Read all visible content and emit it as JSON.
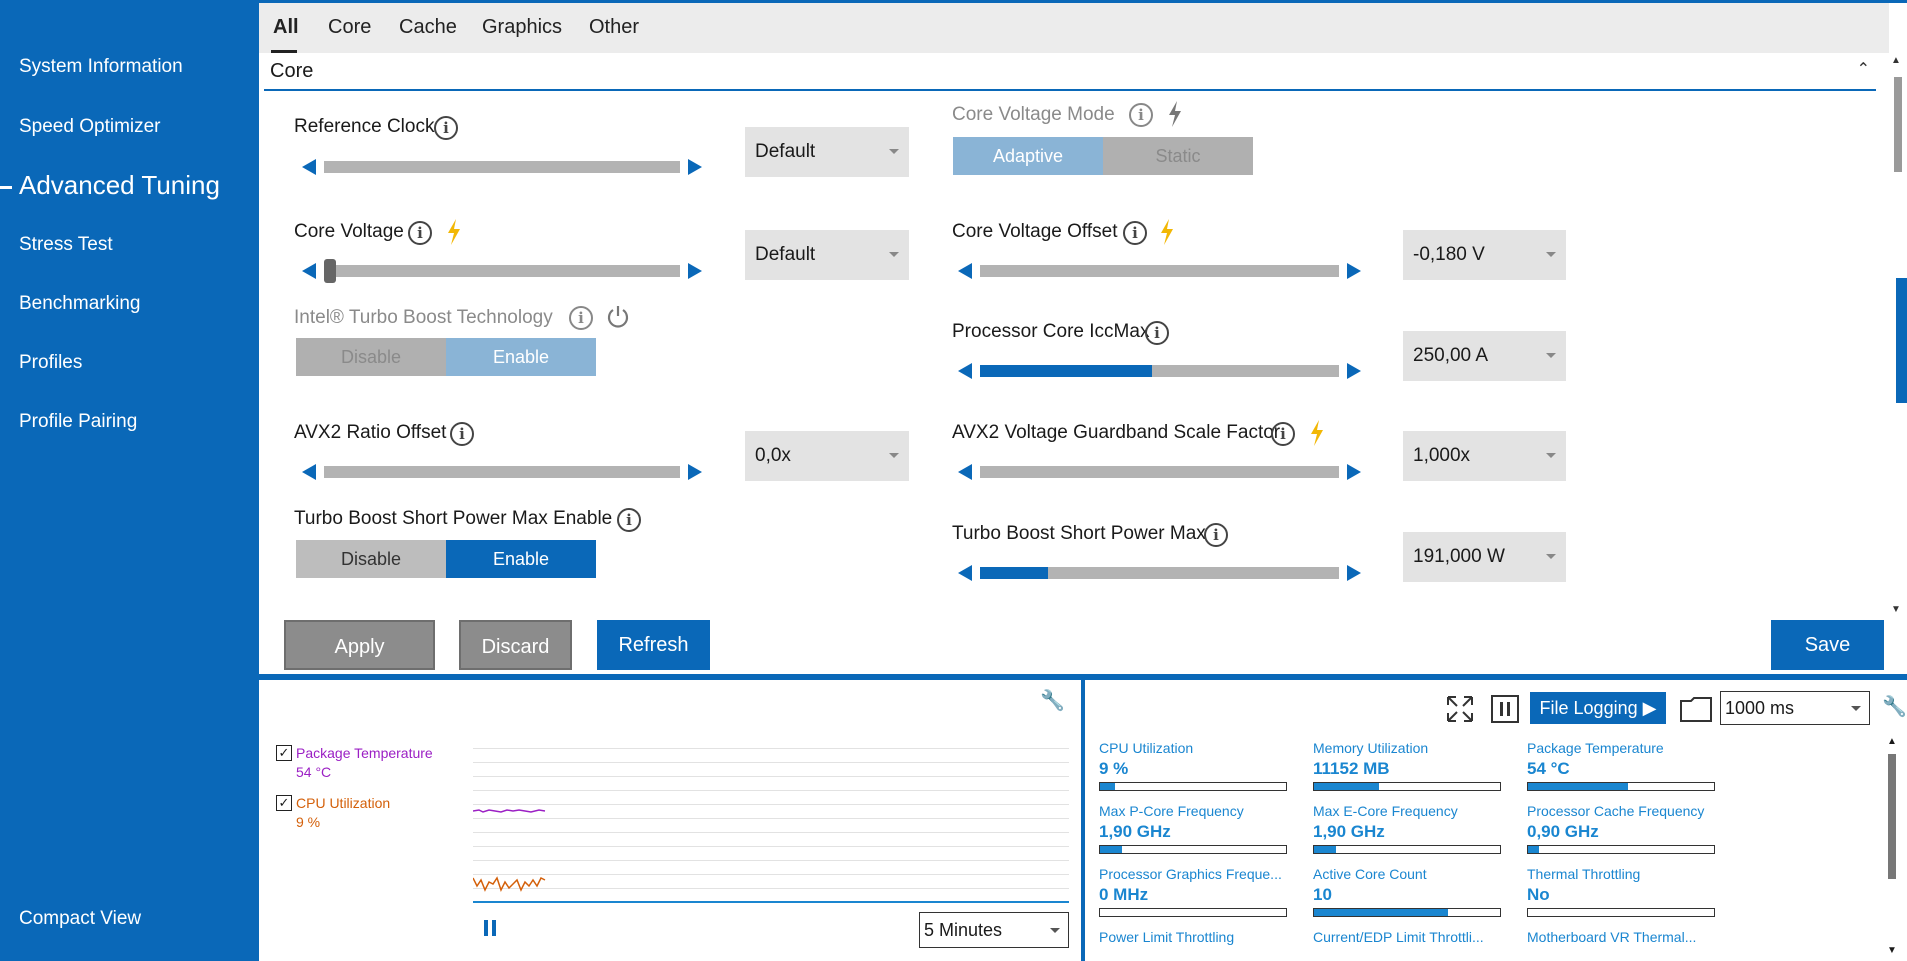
{
  "sidebar": {
    "items": [
      {
        "label": "System Information"
      },
      {
        "label": "Speed Optimizer"
      },
      {
        "label": "Advanced Tuning"
      },
      {
        "label": "Stress Test"
      },
      {
        "label": "Benchmarking"
      },
      {
        "label": "Profiles"
      },
      {
        "label": "Profile Pairing"
      }
    ],
    "active_index": 2,
    "compact_view": "Compact View"
  },
  "tabs": [
    {
      "label": "All"
    },
    {
      "label": "Core"
    },
    {
      "label": "Cache"
    },
    {
      "label": "Graphics"
    },
    {
      "label": "Other"
    }
  ],
  "section": {
    "title": "Core"
  },
  "controls": {
    "reference_clock": {
      "label": "Reference Clock",
      "dropdown": "Default"
    },
    "core_voltage": {
      "label": "Core Voltage",
      "dropdown": "Default"
    },
    "turbo_boost_tech": {
      "label": "Intel® Turbo Boost Technology",
      "disable": "Disable",
      "enable": "Enable",
      "selected": "Enable"
    },
    "avx2_ratio_offset": {
      "label": "AVX2 Ratio Offset",
      "dropdown": "0,0x"
    },
    "turbo_short_power_max_enable": {
      "label": "Turbo Boost Short Power Max Enable",
      "disable": "Disable",
      "enable": "Enable",
      "selected": "Enable"
    },
    "core_voltage_mode": {
      "label": "Core Voltage Mode",
      "adaptive": "Adaptive",
      "static": "Static",
      "selected": "Adaptive"
    },
    "core_voltage_offset": {
      "label": "Core Voltage Offset",
      "dropdown": "-0,180 V"
    },
    "processor_core_iccmax": {
      "label": "Processor Core IccMax",
      "dropdown": "250,00 A",
      "level": 0.48
    },
    "avx2_guardband": {
      "label": "AVX2 Voltage Guardband Scale Factor",
      "dropdown": "1,000x"
    },
    "turbo_short_power_max": {
      "label": "Turbo Boost Short Power Max",
      "dropdown": "191,000 W",
      "level": 0.19
    }
  },
  "actions": {
    "apply": "Apply",
    "discard": "Discard",
    "refresh": "Refresh",
    "save": "Save"
  },
  "graph": {
    "legend": [
      {
        "name": "Package Temperature",
        "value": "54 °C",
        "color": "#9b1fc4"
      },
      {
        "name": "CPU Utilization",
        "value": "9 %",
        "color": "#d4600a"
      }
    ],
    "range": "5 Minutes"
  },
  "monitor": {
    "file_logging": "File Logging ▶",
    "interval": "1000 ms",
    "metrics": [
      {
        "label": "CPU Utilization",
        "value": "9 %",
        "level": 0.08
      },
      {
        "label": "Memory Utilization",
        "value": "11152  MB",
        "level": 0.35
      },
      {
        "label": "Package Temperature",
        "value": "54 °C",
        "level": 0.54
      },
      {
        "label": "Max P-Core Frequency",
        "value": "1,90 GHz",
        "level": 0.12
      },
      {
        "label": "Max E-Core Frequency",
        "value": "1,90 GHz",
        "level": 0.12
      },
      {
        "label": "Processor Cache Frequency",
        "value": "0,90 GHz",
        "level": 0.06
      },
      {
        "label": "Processor Graphics Freque...",
        "value": "0 MHz",
        "level": 0.0
      },
      {
        "label": "Active Core Count",
        "value": "10",
        "level": 0.72
      },
      {
        "label": "Thermal Throttling",
        "value": "No",
        "level": 0.0
      },
      {
        "label": "Power Limit Throttling",
        "value": "",
        "level": 0.0
      },
      {
        "label": "Current/EDP Limit Throttli...",
        "value": "",
        "level": 0.0
      },
      {
        "label": "Motherboard VR Thermal...",
        "value": "",
        "level": 0.0
      }
    ]
  }
}
